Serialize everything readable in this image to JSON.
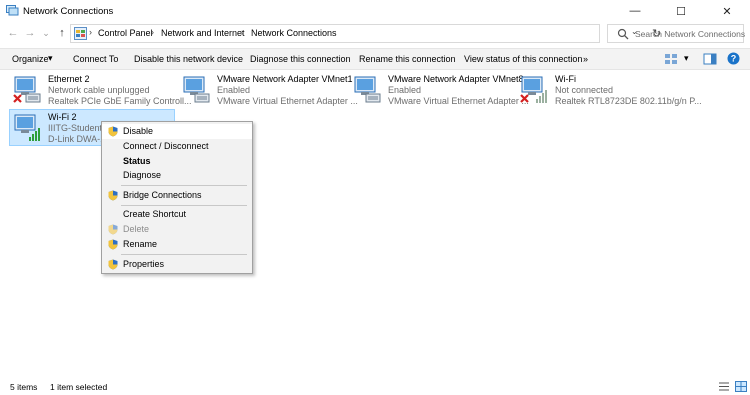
{
  "window": {
    "title": "Network Connections",
    "minimize": "—",
    "maximize": "☐",
    "close": "✕"
  },
  "nav": {
    "back": "←",
    "forward": "→",
    "recent": "⌄",
    "up": "↑"
  },
  "address": {
    "crumbs": [
      "Control Panel",
      "Network and Internet",
      "Network Connections"
    ],
    "sep": "›",
    "dropdown": "⌄",
    "refresh": "↻"
  },
  "search": {
    "placeholder": "Search Network Connections"
  },
  "toolbar": {
    "organize": "Organize",
    "organize_arrow": "▾",
    "connect_to": "Connect To",
    "disable": "Disable this network device",
    "diagnose": "Diagnose this connection",
    "rename": "Rename this connection",
    "view_status": "View status of this connection",
    "more": "»",
    "view_arrow": "▾",
    "help": "?"
  },
  "connections": [
    {
      "name": "Ethernet 2",
      "status": "Network cable unplugged",
      "device": "Realtek PCIe GbE Family Controll...",
      "icon": "ethernet-disconnected-icon"
    },
    {
      "name": "VMware Network Adapter VMnet1",
      "status": "Enabled",
      "device": "VMware Virtual Ethernet Adapter ...",
      "icon": "ethernet-adapter-icon"
    },
    {
      "name": "VMware Network Adapter VMnet8",
      "status": "Enabled",
      "device": "VMware Virtual Ethernet Adapter ...",
      "icon": "ethernet-adapter-icon"
    },
    {
      "name": "Wi-Fi",
      "status": "Not connected",
      "device": "Realtek RTL8723DE 802.11b/g/n P...",
      "icon": "wifi-disconnected-icon"
    },
    {
      "name": "Wi-Fi 2",
      "status": "IIITG-Student",
      "device": "D-Link DWA-1",
      "icon": "wifi-connected-icon"
    }
  ],
  "context_menu": {
    "items": [
      {
        "label": "Disable",
        "shield": true
      },
      {
        "label": "Connect / Disconnect",
        "shield": false
      },
      {
        "label": "Status",
        "shield": false,
        "bold": true
      },
      {
        "label": "Diagnose",
        "shield": false
      },
      {
        "label": "Bridge Connections",
        "shield": true
      },
      {
        "label": "Create Shortcut",
        "shield": false
      },
      {
        "label": "Delete",
        "shield": true,
        "disabled": true
      },
      {
        "label": "Rename",
        "shield": true
      },
      {
        "label": "Properties",
        "shield": true
      }
    ]
  },
  "status_bar": {
    "items_count": "5 items",
    "selected": "1 item selected"
  },
  "colors": {
    "selection_bg": "#cce8ff",
    "selection_border": "#99d1ff",
    "signal_green": "#2e9e3a",
    "error_red": "#d42020",
    "help_blue": "#1a73c9"
  }
}
